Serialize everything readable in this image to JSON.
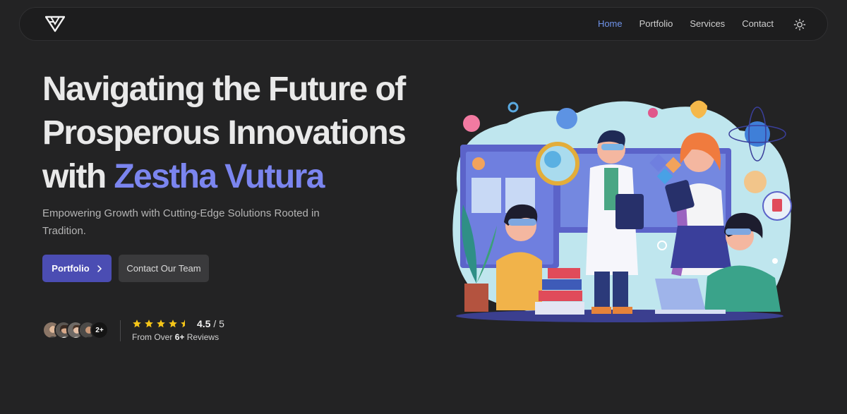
{
  "nav": {
    "links": [
      "Home",
      "Portfolio",
      "Services",
      "Contact"
    ],
    "active": "Home",
    "theme_icon": "sun-icon"
  },
  "hero": {
    "title_line1": "Navigating the Future of",
    "title_line2": "Prosperous Innovations",
    "title_prefix": "with",
    "brand": "Zestha Vutura",
    "subtitle": "Empowering Growth with Cutting-Edge Solutions Rooted in Tradition.",
    "primary_button": "Portfolio",
    "secondary_button": "Contact Our Team"
  },
  "social_proof": {
    "avatar_more": "2+",
    "rating_value": "4.5",
    "rating_max": "/ 5",
    "stars": 4.5,
    "reviews_prefix": "From Over",
    "reviews_count": "6+",
    "reviews_suffix": "Reviews"
  },
  "colors": {
    "background": "#232324",
    "accent": "#7b85ef",
    "nav_active": "#6f93ea",
    "primary_button": "#4b4db3",
    "star": "#f5c518"
  }
}
